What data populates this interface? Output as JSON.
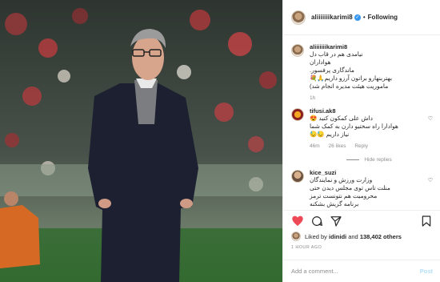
{
  "post": {
    "username": "aliiiiiiikarimi8",
    "follow_label": "Following",
    "separator": "•",
    "verified_glyph": "✓",
    "caption": {
      "username": "aliiiiiiikarimi8",
      "text_lines": [
        "نیامدی هم در قاب دل",
        "هواداران",
        "ماندگاری پرفسور.",
        "بهتربنهارو براتون آرزو داریم🙏💐",
        "ماموریت هیئت مدیره انجام شد)"
      ],
      "time": "1h"
    },
    "comments": [
      {
        "username": "tifusi.ak8",
        "text_lines": [
          "داش علی کمکون کنید 😍",
          "هوادارا راه سختیو دارن به کمک شما",
          "نیاز داریم 😓😓"
        ],
        "time": "46m",
        "likes": "26 likes",
        "reply_label": "Reply",
        "hide_label": "Hide replies"
      },
      {
        "username": "kice_suzi",
        "text_lines": [
          "وزارت ورزش و نمایندگان",
          "منلت تاس توی مجلس دیدن حتی",
          "محرومیت هم نتونست ترمز",
          "برنامه گزیش بشکنه"
        ]
      }
    ],
    "likes": {
      "prefix": "Liked by",
      "user": "idinidi",
      "middle": "and",
      "count": "138,402 others"
    },
    "time_ago": "1 HOUR AGO",
    "add_comment_placeholder": "Add a comment...",
    "post_label": "Post",
    "icons": {
      "like": "heart-filled-icon",
      "comment": "comment-icon",
      "share": "share-icon",
      "save": "bookmark-icon",
      "comment_like": "heart-outline-icon"
    },
    "colors": {
      "like": "#ed4956",
      "verified": "#3897f0",
      "post_button": "#b2dffc"
    }
  }
}
